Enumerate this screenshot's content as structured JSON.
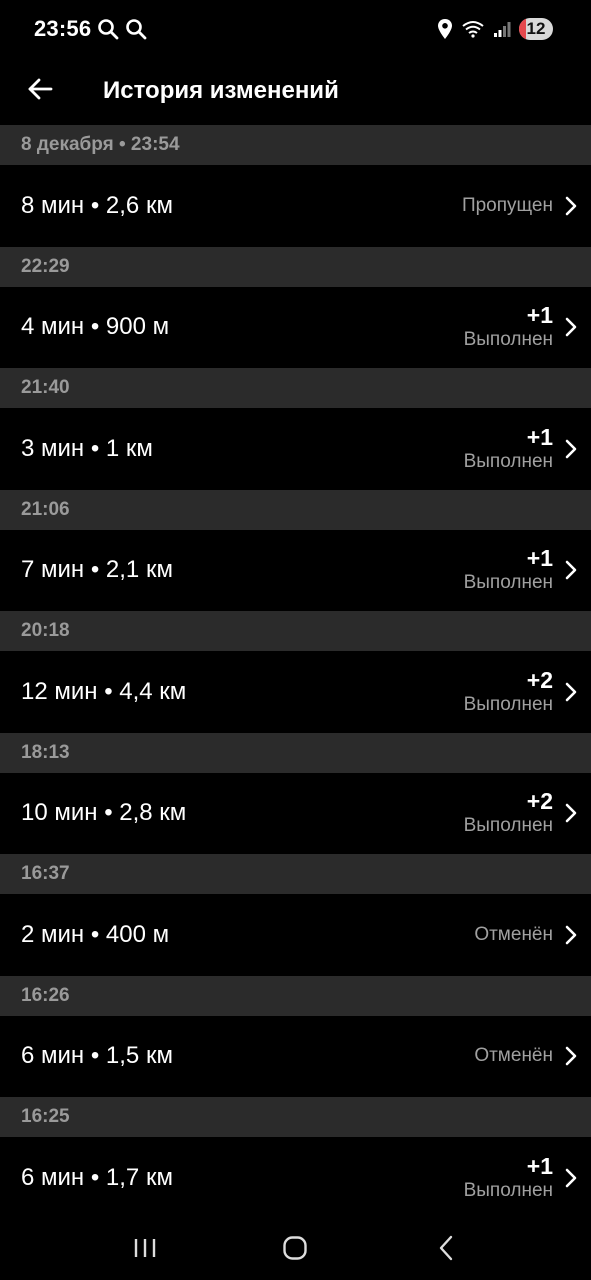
{
  "status_bar": {
    "time": "23:56",
    "battery": "12"
  },
  "header": {
    "title": "История изменений"
  },
  "history": [
    {
      "header": "8 декабря • 23:54",
      "summary": "8 мин • 2,6 км",
      "points": "",
      "status": "Пропущен"
    },
    {
      "header": "22:29",
      "summary": "4 мин • 900 м",
      "points": "+1",
      "status": "Выполнен"
    },
    {
      "header": "21:40",
      "summary": "3 мин • 1 км",
      "points": "+1",
      "status": "Выполнен"
    },
    {
      "header": "21:06",
      "summary": "7 мин • 2,1 км",
      "points": "+1",
      "status": "Выполнен"
    },
    {
      "header": "20:18",
      "summary": "12 мин • 4,4 км",
      "points": "+2",
      "status": "Выполнен"
    },
    {
      "header": "18:13",
      "summary": "10 мин • 2,8 км",
      "points": "+2",
      "status": "Выполнен"
    },
    {
      "header": "16:37",
      "summary": "2 мин • 400 м",
      "points": "",
      "status": "Отменён"
    },
    {
      "header": "16:26",
      "summary": "6 мин • 1,5 км",
      "points": "",
      "status": "Отменён"
    },
    {
      "header": "16:25",
      "summary": "6 мин • 1,7 км",
      "points": "+1",
      "status": "Выполнен"
    }
  ]
}
